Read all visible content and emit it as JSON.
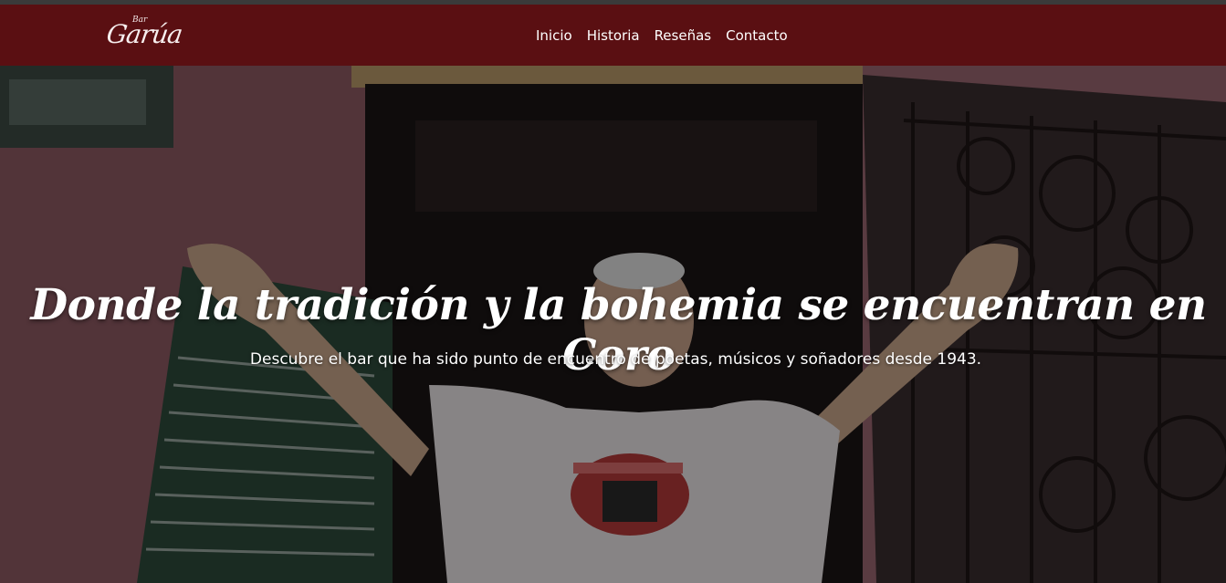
{
  "brand": {
    "logo_small": "Bar",
    "logo_main": "Garúa"
  },
  "nav": {
    "items": [
      {
        "label": "Inicio"
      },
      {
        "label": "Historia"
      },
      {
        "label": "Reseñas"
      },
      {
        "label": "Contacto"
      }
    ]
  },
  "hero": {
    "title": "Donde la tradición y la bohemia se encuentran en Coro",
    "subtitle": "Descubre el bar que ha sido punto de encuentro de poetas, músicos y soñadores desde 1943.",
    "background_icon": "photo-man-in-doorway"
  },
  "colors": {
    "navbar": "#5a0f12",
    "text": "#ffffff"
  }
}
